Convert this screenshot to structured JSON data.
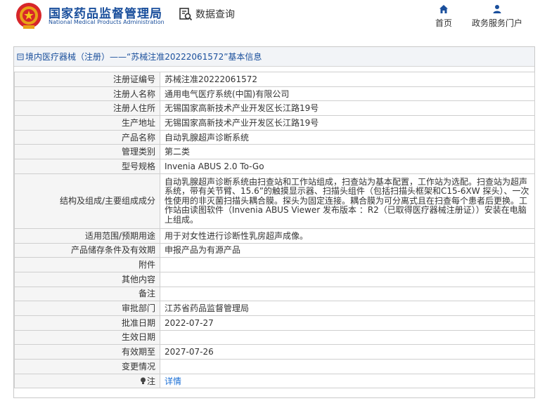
{
  "header": {
    "logo_cn": "国家药品监督管理局",
    "logo_en": "National Medical Products Administration",
    "query_label": "数据查询",
    "nav_home": "首页",
    "nav_portal": "政务服务门户",
    "icons": {
      "emblem": "national-emblem-icon",
      "query": "data-query-icon",
      "home": "home-icon",
      "portal": "user-icon"
    },
    "brand_color": "#1a4f9c"
  },
  "breadcrumb": {
    "text": "境内医疗器械（注册）——“苏械注准20222061572”基本信息"
  },
  "rows": [
    {
      "key": "注册证编号",
      "value": "苏械注准20222061572"
    },
    {
      "key": "注册人名称",
      "value": "通用电气医疗系统(中国)有限公司"
    },
    {
      "key": "注册人住所",
      "value": "无锡国家高新技术产业开发区长江路19号"
    },
    {
      "key": "生产地址",
      "value": "无锡国家高新技术产业开发区长江路19号"
    },
    {
      "key": "产品名称",
      "value": "自动乳腺超声诊断系统"
    },
    {
      "key": "管理类别",
      "value": "第二类"
    },
    {
      "key": "型号规格",
      "value": "Invenia ABUS 2.0 To-Go"
    },
    {
      "key": "结构及组成/主要组成成分",
      "value": "自动乳腺超声诊断系统由扫查站和工作站组成，扫查站为基本配置，工作站为选配。扫查站为超声系统，带有关节臂、15.6”的触摸显示器、扫描头组件（包括扫描头框架和C15-6XW 探头）、一次性使用的非灭菌扫描头耦合膜。探头为固定连接。耦合膜为可分离式且在扫查每个患者后更换。工作站由读图软件（Invenia ABUS Viewer 发布版本 ：R2（已取得医疗器械注册证））安装在电脑上组成。"
    },
    {
      "key": "适用范围/预期用途",
      "value": "用于对女性进行诊断性乳房超声成像。"
    },
    {
      "key": "产品储存条件及有效期",
      "value": "申报产品为有源产品"
    },
    {
      "key": "附件",
      "value": ""
    },
    {
      "key": "其他内容",
      "value": ""
    },
    {
      "key": "备注",
      "value": ""
    },
    {
      "key": "审批部门",
      "value": "江苏省药品监督管理局"
    },
    {
      "key": "批准日期",
      "value": "2022-07-27"
    },
    {
      "key": "生效日期",
      "value": ""
    },
    {
      "key": "有效期至",
      "value": "2027-07-26"
    },
    {
      "key": "变更情况",
      "value": ""
    },
    {
      "key": "注",
      "value": "详情"
    }
  ]
}
